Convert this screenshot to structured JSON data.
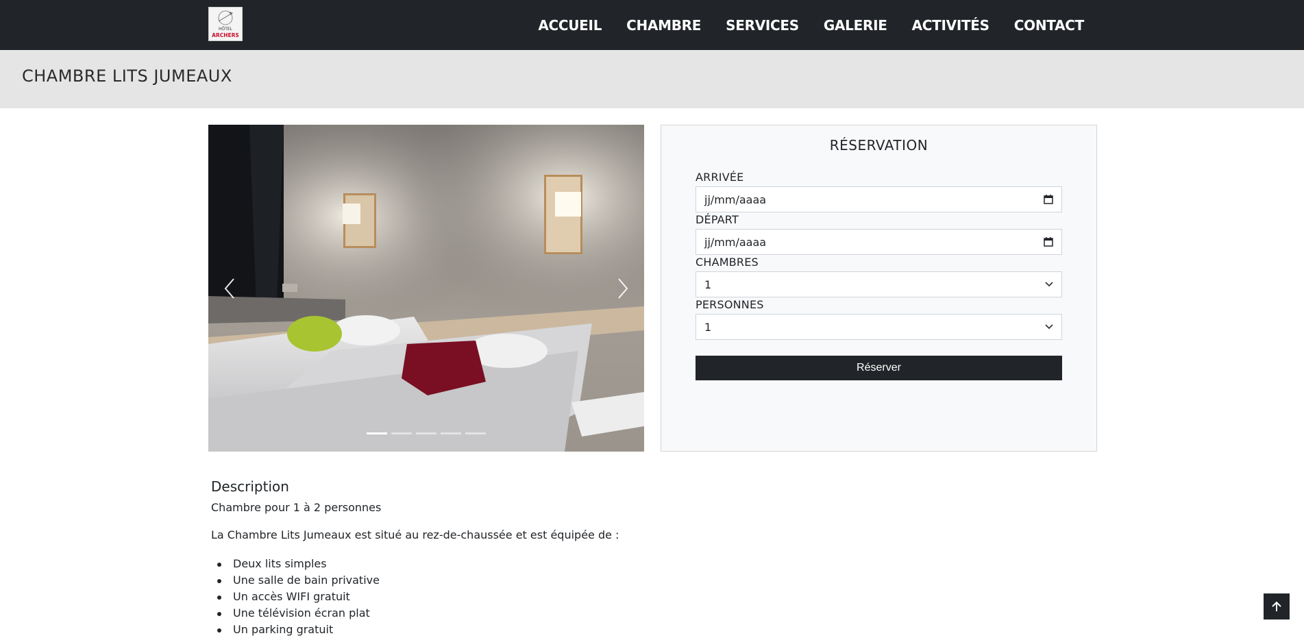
{
  "logo": {
    "line1": "HÔTEL",
    "line2": "ARCHERS"
  },
  "nav": {
    "items": [
      "ACCUEIL",
      "CHAMBRE",
      "SERVICES",
      "GALERIE",
      "ACTIVITÉS",
      "CONTACT"
    ]
  },
  "page": {
    "title": "CHAMBRE LITS JUMEAUX"
  },
  "carousel": {
    "slide_count": 5,
    "active_index": 0,
    "prev_icon": "chevron-left-icon",
    "next_icon": "chevron-right-icon"
  },
  "reservation": {
    "title": "RÉSERVATION",
    "arrival": {
      "label": "ARRIVÉE",
      "value": "jj/mm/aaaa"
    },
    "departure": {
      "label": "DÉPART",
      "value": "jj/mm/aaaa"
    },
    "rooms": {
      "label": "CHAMBRES",
      "value": "1"
    },
    "persons": {
      "label": "PERSONNES",
      "value": "1"
    },
    "button": "Réserver"
  },
  "description": {
    "heading": "Description",
    "intro": "Chambre pour 1 à 2 personnes",
    "text": "La Chambre Lits Jumeaux est situé au rez-de-chaussée et est équipée de :",
    "items": [
      "Deux lits simples",
      "Une salle de bain privative",
      "Un accès WIFI gratuit",
      "Une télévision écran plat",
      "Un parking gratuit"
    ]
  },
  "colors": {
    "navbar": "#212529",
    "title_band": "#e5e5e5",
    "button": "#212529",
    "panel": "#f8f9fa"
  }
}
